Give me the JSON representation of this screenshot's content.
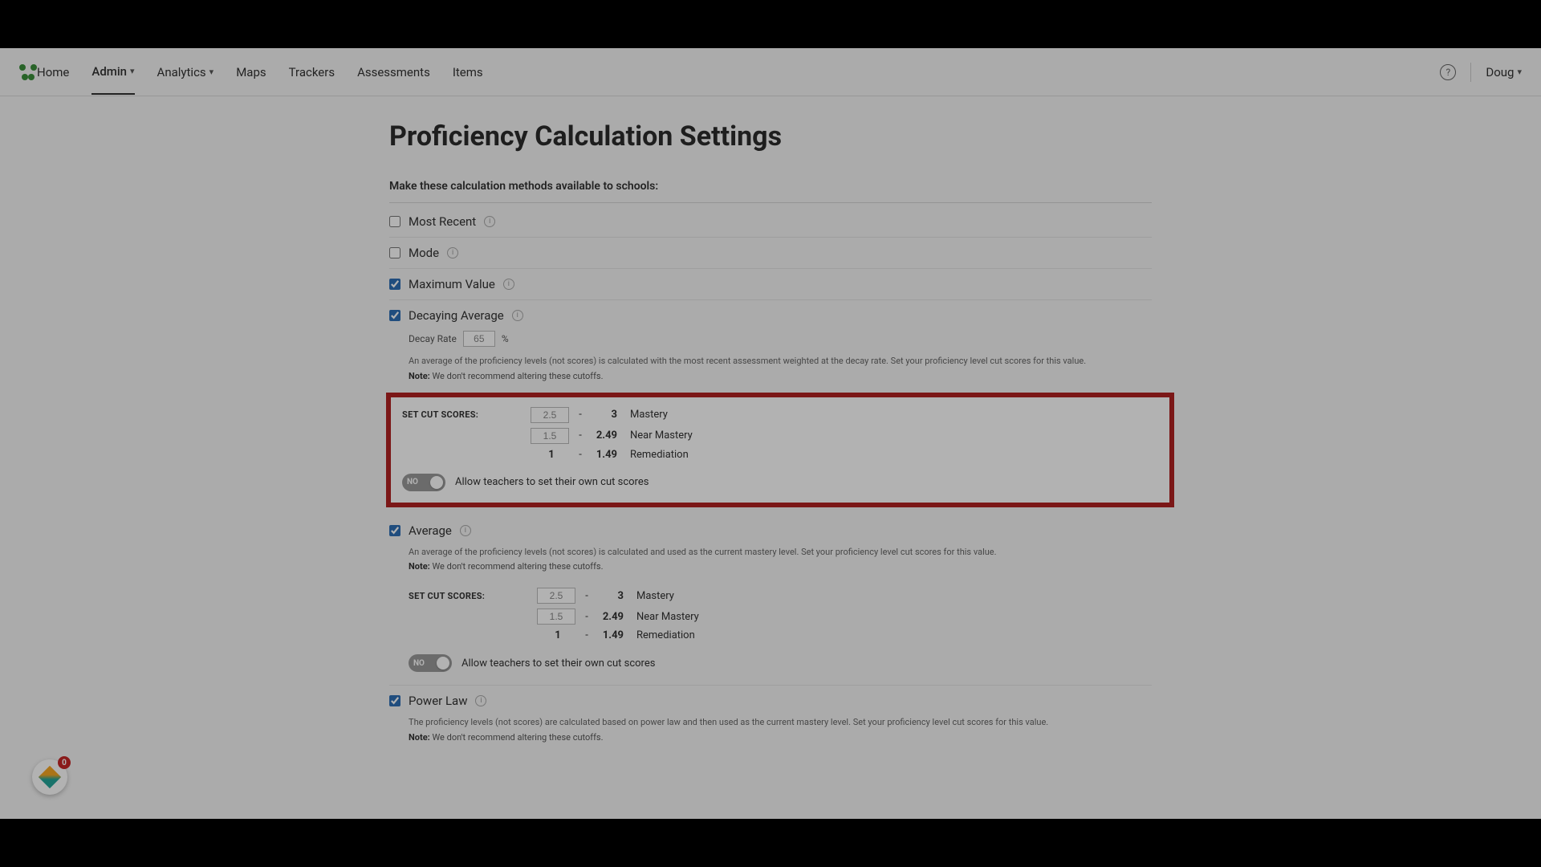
{
  "nav": {
    "home": "Home",
    "admin": "Admin",
    "analytics": "Analytics",
    "maps": "Maps",
    "trackers": "Trackers",
    "assessments": "Assessments",
    "items": "Items"
  },
  "user": {
    "name": "Doug"
  },
  "page": {
    "title": "Proficiency Calculation Settings",
    "subtitle": "Make these calculation methods available to schools:"
  },
  "methods": {
    "most_recent": {
      "label": "Most Recent",
      "checked": false
    },
    "mode": {
      "label": "Mode",
      "checked": false
    },
    "maximum_value": {
      "label": "Maximum Value",
      "checked": true
    },
    "decaying_average": {
      "label": "Decaying Average",
      "checked": true,
      "decay_rate_label": "Decay Rate",
      "decay_rate_value": "65",
      "decay_rate_unit": "%",
      "desc": "An average of the proficiency levels (not scores) is calculated with the most recent assessment weighted at the decay rate. Set your proficiency level cut scores for this value.",
      "note_label": "Note:",
      "note_text": "We don't recommend altering these cutoffs."
    },
    "average": {
      "label": "Average",
      "checked": true,
      "desc": "An average of the proficiency levels (not scores) is calculated and used as the current mastery level. Set your proficiency level cut scores for this value.",
      "note_label": "Note:",
      "note_text": "We don't recommend altering these cutoffs."
    },
    "power_law": {
      "label": "Power Law",
      "checked": true,
      "desc": "The proficiency levels (not scores) are calculated based on power law and then used as the current mastery level. Set your proficiency level cut scores for this value.",
      "note_label": "Note:",
      "note_text": "We don't recommend altering these cutoffs."
    }
  },
  "cutscores": {
    "header": "Set Cut Scores:",
    "rows": [
      {
        "low": "2.5",
        "high": "3",
        "label": "Mastery",
        "editable": true
      },
      {
        "low": "1.5",
        "high": "2.49",
        "label": "Near Mastery",
        "editable": true
      },
      {
        "low": "1",
        "high": "1.49",
        "label": "Remediation",
        "editable": false
      }
    ],
    "toggle_state": "NO",
    "toggle_text": "Allow teachers to set their own cut scores"
  },
  "widget": {
    "badge": "0"
  }
}
